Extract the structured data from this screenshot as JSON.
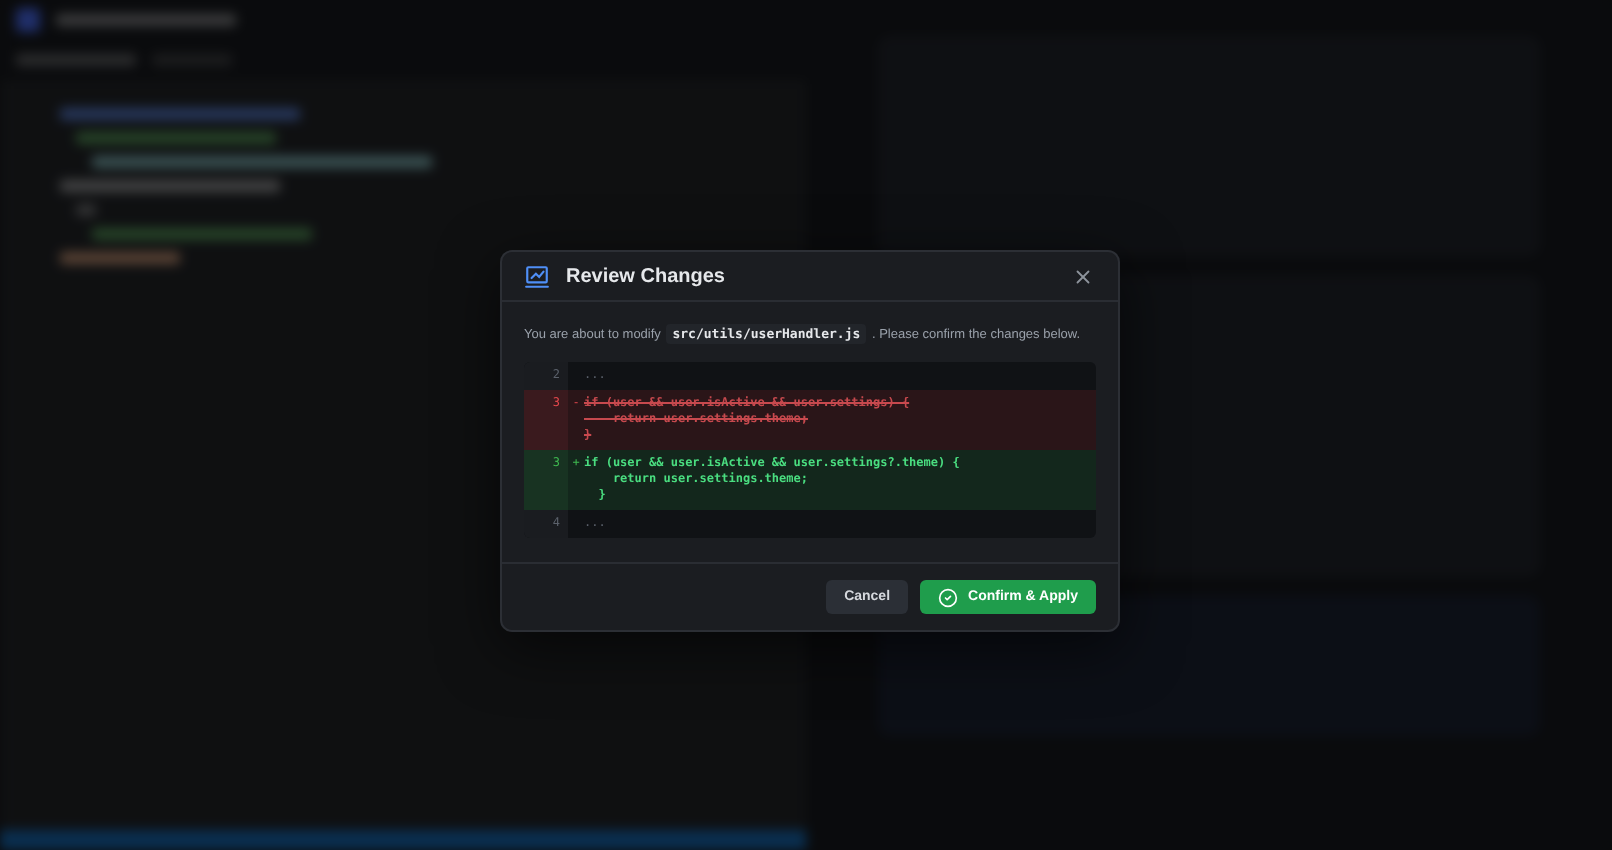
{
  "dialog": {
    "title": "Review Changes",
    "message_before": "You are about to modify",
    "file_path": "src/utils/userHandler.js",
    "message_after": ". Please confirm the changes below.",
    "diff": [
      {
        "kind": "context",
        "number": "2",
        "lines": [
          "..."
        ]
      },
      {
        "kind": "removed",
        "number": "3",
        "marker": "-",
        "lines": [
          "if (user && user.isActive && user.settings) {",
          "    return user.settings.theme;",
          "}"
        ]
      },
      {
        "kind": "added",
        "number": "3",
        "marker": "+",
        "lines": [
          "if (user && user.isActive && user.settings?.theme) {",
          "    return user.settings.theme;",
          "  }"
        ]
      },
      {
        "kind": "context",
        "number": "4",
        "lines": [
          "..."
        ]
      }
    ],
    "buttons": [
      {
        "label": "Cancel",
        "kind": "secondary"
      },
      {
        "label": "Confirm & Apply",
        "kind": "primary"
      }
    ]
  }
}
